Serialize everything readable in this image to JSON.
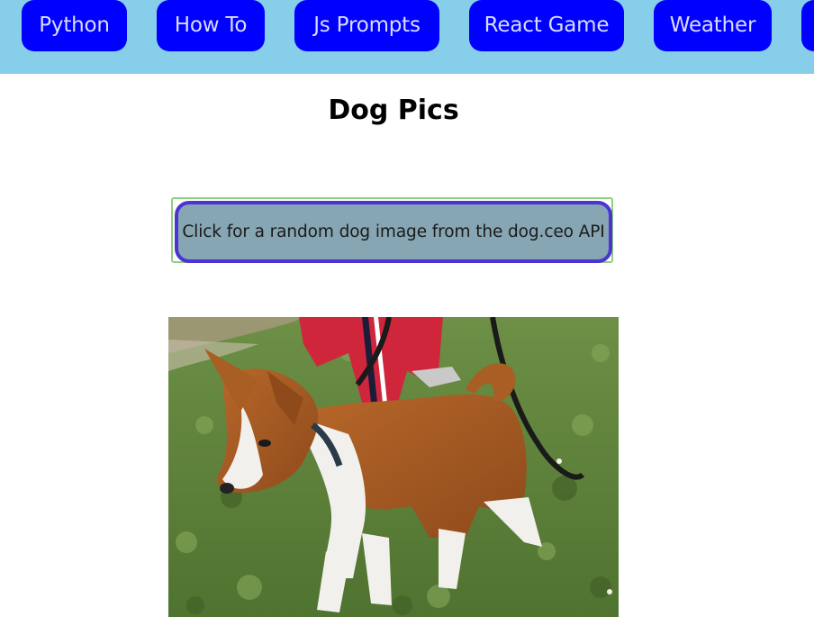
{
  "nav": {
    "items": [
      {
        "label": "Python"
      },
      {
        "label": "How To"
      },
      {
        "label": "Js Prompts"
      },
      {
        "label": "React Game"
      },
      {
        "label": "Weather"
      },
      {
        "label": ""
      }
    ]
  },
  "main": {
    "title": "Dog Pics",
    "button_label": "Click for a random dog image from the dog.ceo API",
    "image_subject": "basenji-puppy-on-leash"
  },
  "colors": {
    "nav_background": "#87ceeb",
    "nav_button": "#0000ff",
    "nav_button_text": "#d8dcff",
    "button_background": "#86a6b3",
    "button_border": "#4b34d3",
    "button_outline": "#8fd07f"
  }
}
